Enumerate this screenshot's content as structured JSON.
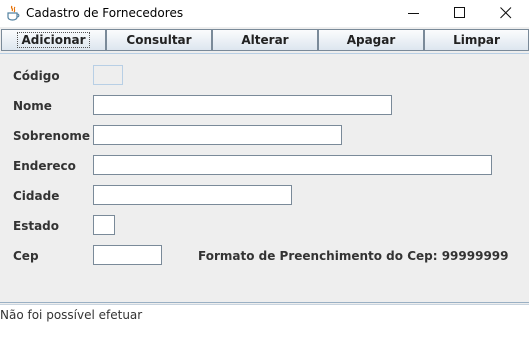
{
  "window": {
    "title": "Cadastro de Fornecedores",
    "app_icon": "java-cup-icon",
    "controls": [
      "minimize-icon",
      "maximize-icon",
      "close-icon"
    ]
  },
  "toolbar": {
    "adicionar": "Adicionar",
    "consultar": "Consultar",
    "alterar": "Alterar",
    "apagar": "Apagar",
    "limpar": "Limpar"
  },
  "form": {
    "codigo": {
      "label": "Código",
      "value": ""
    },
    "nome": {
      "label": "Nome",
      "value": ""
    },
    "sobrenome": {
      "label": "Sobrenome",
      "value": ""
    },
    "endereco": {
      "label": "Endereco",
      "value": ""
    },
    "cidade": {
      "label": "Cidade",
      "value": ""
    },
    "estado": {
      "label": "Estado",
      "value": ""
    },
    "cep": {
      "label": "Cep",
      "value": ""
    },
    "cep_hint": "Formato de Preenchimento do Cep: 99999999"
  },
  "status": {
    "message": "Não foi possível efetuar"
  },
  "colors": {
    "background": "#eeeeee",
    "button_border": "#7a8a99",
    "field_border": "#7a8a99",
    "label_text": "#333333"
  }
}
